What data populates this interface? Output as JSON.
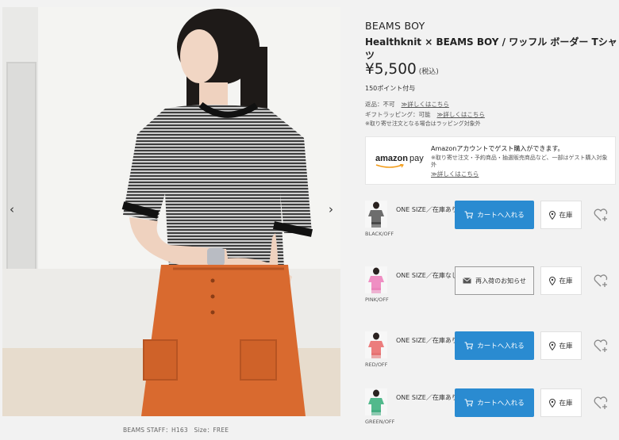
{
  "product": {
    "brand": "BEAMS BOY",
    "title": "Healthknit × BEAMS BOY / ワッフル ボーダー Tシャツ",
    "price": "¥5,500",
    "tax": "(税込)",
    "points": "150ポイント付与"
  },
  "info": {
    "returns_label": "返品：不可",
    "returns_link": "≫詳しくはこちら",
    "gift_label": "ギフトラッピング：可能",
    "gift_link": "≫詳しくはこちら",
    "gift_note": "※取り寄せ注文となる場合はラッピング対象外"
  },
  "photo": {
    "caption": "BEAMS STAFF：H163　Size：FREE",
    "prev_icon": "chevron-left-icon",
    "next_icon": "chevron-right-icon"
  },
  "amazon_pay": {
    "logo_amazon": "amazon",
    "logo_pay": "pay",
    "headline": "Amazonアカウントでゲスト購入ができます。",
    "note": "※取り寄せ注文・予約商品・抽選販売商品など、一部はゲスト購入対象外",
    "link": "≫詳しくはこちら"
  },
  "variants": [
    {
      "color": "BLACK/OFF",
      "size": "ONE SIZE／在庫あり",
      "action": "カートへ入れる",
      "action_type": "cart",
      "stock": "在庫",
      "swatch": "#2b2b2b",
      "shirt": "#6d6d6d"
    },
    {
      "color": "PINK/OFF",
      "size": "ONE SIZE／在庫なし",
      "action": "再入荷のお知らせ",
      "action_type": "notify",
      "stock": "在庫",
      "swatch": "#e77bb4",
      "shirt": "#ef8fc3"
    },
    {
      "color": "RED/OFF",
      "size": "ONE SIZE／在庫あり",
      "action": "カートへ入れる",
      "action_type": "cart",
      "stock": "在庫",
      "swatch": "#e06a6a",
      "shirt": "#ec7d7d"
    },
    {
      "color": "GREEN/OFF",
      "size": "ONE SIZE／在庫あり",
      "action": "カートへ入れる",
      "action_type": "cart",
      "stock": "在庫",
      "swatch": "#3aa57a",
      "shirt": "#52b98c"
    }
  ],
  "colors": {
    "cart_button": "#2a8bd1",
    "background": "#f2f2f2"
  }
}
